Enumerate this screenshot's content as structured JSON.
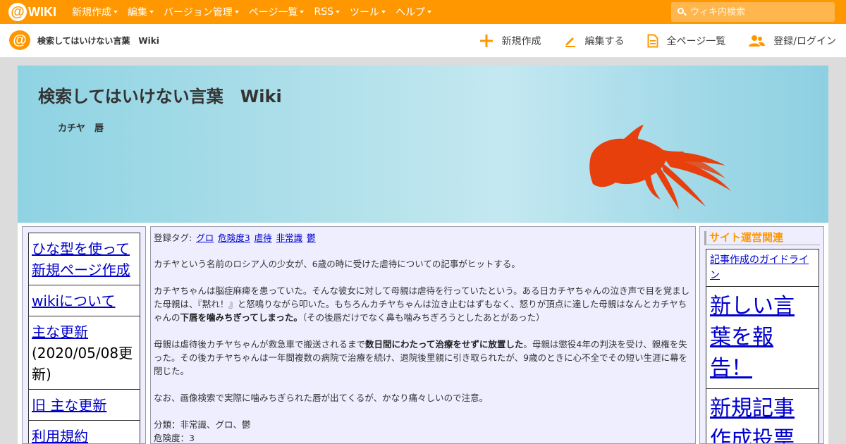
{
  "topbar": {
    "logo_text": "WIKI",
    "menu": [
      {
        "label": "新規作成"
      },
      {
        "label": "編集"
      },
      {
        "label": "バージョン管理"
      },
      {
        "label": "ページ一覧"
      },
      {
        "label": "RSS"
      },
      {
        "label": "ツール"
      },
      {
        "label": "ヘルプ"
      }
    ],
    "search_placeholder": "ウィキ内検索"
  },
  "subbar": {
    "site_name": "検索してはいけない言葉　Wiki",
    "actions": [
      {
        "label": "新規作成",
        "icon": "plus-icon"
      },
      {
        "label": "編集する",
        "icon": "pencil-icon"
      },
      {
        "label": "全ページ一覧",
        "icon": "document-icon"
      },
      {
        "label": "登録/ログイン",
        "icon": "users-icon"
      }
    ]
  },
  "banner": {
    "title": "検索してはいけない言葉　Wiki",
    "subtitle": "カチヤ　唇"
  },
  "left_menu": {
    "items": [
      {
        "link": "ひな型を使って新規ページ作成",
        "note": ""
      },
      {
        "link": "wikiについて",
        "note": ""
      },
      {
        "link": "主な更新",
        "note": "(2020/05/08更新)"
      },
      {
        "link": "旧 主な更新",
        "note": ""
      },
      {
        "link": "利用規約",
        "note": ""
      }
    ]
  },
  "main": {
    "tags_label": "登録タグ:",
    "tags": [
      "グロ",
      "危険度3",
      "虐待",
      "非常識",
      "鬱"
    ],
    "p1": "カチヤという名前のロシア人の少女が、6歳の時に受けた虐待についての記事がヒットする。",
    "p2_a": "カチヤちゃんは脳症麻痺を患っていた。そんな彼女に対して母親は虐待を行っていたという。ある日カチヤちゃんの泣き声で目を覚ました母親は、『黙れ！』と怒鳴りながら叩いた。もちろんカチヤちゃんは泣き止むはずもなく、怒りが頂点に達した母親はなんとカチヤちゃんの",
    "p2_bold": "下唇を噛みちぎってしまった。",
    "p2_b": "（その後唇だけでなく鼻も噛みちぎろうとしたあとがあった）",
    "p3_a": "母親は虐待後カチヤちゃんが救急車で搬送されるまで",
    "p3_bold": "数日間にわたって治療をせずに放置した",
    "p3_b": "。母親は懲役4年の判決を受け、親権を失った。その後カチヤちゃんは一年間複数の病院で治療を続け、退院後里親に引き取られたが、9歳のときに心不全でその短い生涯に幕を閉じた。",
    "p4": "なお、画像検索で実際に噛みちぎられた唇が出てくるが、かなり痛々しいので注意。",
    "category": "分類：非常識、グロ、鬱",
    "danger": "危険度：3"
  },
  "right": {
    "heading": "サイト運営関連",
    "items": [
      {
        "label": "記事作成のガイドライン",
        "size": "small"
      },
      {
        "label": "新しい言葉を報告！",
        "size": "big"
      },
      {
        "label": "新規記事作成投票",
        "size": "big"
      }
    ]
  },
  "colors": {
    "topbar": "#ff9800",
    "link": "#0000cc",
    "panel_bg": "#eeeeff",
    "banner": "#a9dde8",
    "goldfish": "#e8400c"
  }
}
